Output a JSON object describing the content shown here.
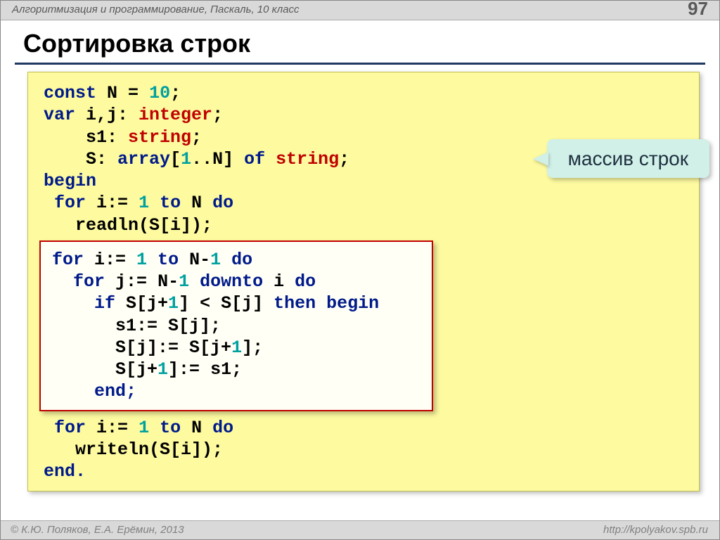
{
  "header": {
    "breadcrumb": "Алгоритмизация и программирование, Паскаль, 10 класс",
    "page_number": "97"
  },
  "title": "Сортировка строк",
  "callout": "массив строк",
  "code": {
    "tokens": {
      "const": "const",
      "var": "var",
      "integer": "integer",
      "string": "string",
      "array": "array",
      "of": "of",
      "begin": "begin",
      "for": "for",
      "to": "to",
      "do": "do",
      "downto": "downto",
      "if": "if",
      "then": "then",
      "end_semi": "end;",
      "end_dot": "end."
    },
    "lines": {
      "l1_a": " N",
      "l1_b": "=",
      "l1_n10": "10",
      "l1_c": ";",
      "l2_a": " i,j: ",
      "l2_b": ";",
      "l3_a": "    s1: ",
      "l3_b": ";",
      "l4_a": "    S: ",
      "l4_b": "[",
      "l4_n1": "1",
      "l4_c": "..N] ",
      "l4_d": ";",
      "l6_a": " i:=",
      "l6_n1": "1",
      "l6_b": " ",
      "l6_c": " N ",
      "l7": "   readln(S[i]);",
      "i1_a": " i:=",
      "i1_n1": "1",
      "i1_b": " ",
      "i1_c": " N-",
      "i1_nm1": "1",
      "i1_d": " ",
      "i2_a": "  ",
      "i2_b": " j:=",
      "i2_c": "N-",
      "i2_nm1": "1",
      "i2_d": " ",
      "i2_e": " i ",
      "i3_a": "    ",
      "i3_b": " S[j+",
      "i3_n1": "1",
      "i3_c": "]",
      "i3_lt": "<",
      "i3_d": "S[j] ",
      "i3_e": " ",
      "i4": "      s1:=",
      "i4b": "S[j];",
      "i5": "      S[j]:=",
      "i5b": "S[j+",
      "i5_n1": "1",
      "i5c": "];",
      "i6": "      S[j+",
      "i6_n1": "1",
      "i6b": "]:=",
      "i6c": "s1;",
      "i7": "    ",
      "l8_a": " ",
      "l8_b": " i:=",
      "l8_n1": "1",
      "l8_c": " ",
      "l8_d": " N ",
      "l9": "   writeln(S[i]);"
    }
  },
  "footer": {
    "left": "© К.Ю. Поляков, Е.А. Ерёмин, 2013",
    "right": "http://kpolyakov.spb.ru"
  }
}
